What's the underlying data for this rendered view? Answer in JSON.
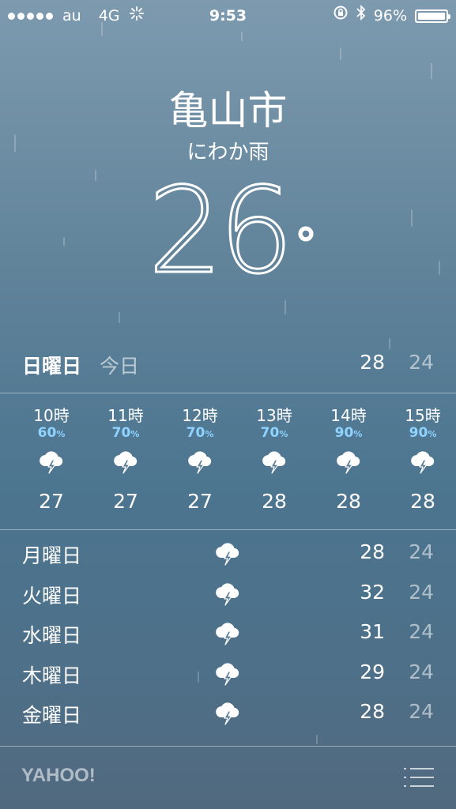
{
  "status_bar": {
    "carrier": "au",
    "network": "4G",
    "time": "9:53",
    "battery": "96%",
    "battery_level": 0.96
  },
  "location": {
    "city": "亀山市",
    "condition": "にわか雨",
    "temperature": "26",
    "degree_symbol": "°"
  },
  "today": {
    "day": "日曜日",
    "label": "今日",
    "high": "28",
    "low": "24"
  },
  "hourly": [
    {
      "time": "10時",
      "pop": "60",
      "pop_unit": "%",
      "icon": "thunderstorm-icon",
      "temp": "27"
    },
    {
      "time": "11時",
      "pop": "70",
      "pop_unit": "%",
      "icon": "thunderstorm-icon",
      "temp": "27"
    },
    {
      "time": "12時",
      "pop": "70",
      "pop_unit": "%",
      "icon": "thunderstorm-icon",
      "temp": "27"
    },
    {
      "time": "13時",
      "pop": "70",
      "pop_unit": "%",
      "icon": "thunderstorm-icon",
      "temp": "28"
    },
    {
      "time": "14時",
      "pop": "90",
      "pop_unit": "%",
      "icon": "thunderstorm-icon",
      "temp": "28"
    },
    {
      "time": "15時",
      "pop": "90",
      "pop_unit": "%",
      "icon": "thunderstorm-icon",
      "temp": "28"
    }
  ],
  "daily": [
    {
      "day": "月曜日",
      "icon": "thunderstorm-icon",
      "high": "28",
      "low": "24"
    },
    {
      "day": "火曜日",
      "icon": "thunderstorm-icon",
      "high": "32",
      "low": "24"
    },
    {
      "day": "水曜日",
      "icon": "thunderstorm-icon",
      "high": "31",
      "low": "24"
    },
    {
      "day": "木曜日",
      "icon": "thunderstorm-icon",
      "high": "29",
      "low": "24"
    },
    {
      "day": "金曜日",
      "icon": "thunderstorm-icon",
      "high": "28",
      "low": "24"
    }
  ],
  "footer": {
    "logo": "YAHOO!",
    "menu_icon": "list-icon"
  },
  "colors": {
    "precip_blue": "#8fd3ff",
    "bg_top": "#7d9aaf",
    "bg_bottom": "#51697f"
  }
}
